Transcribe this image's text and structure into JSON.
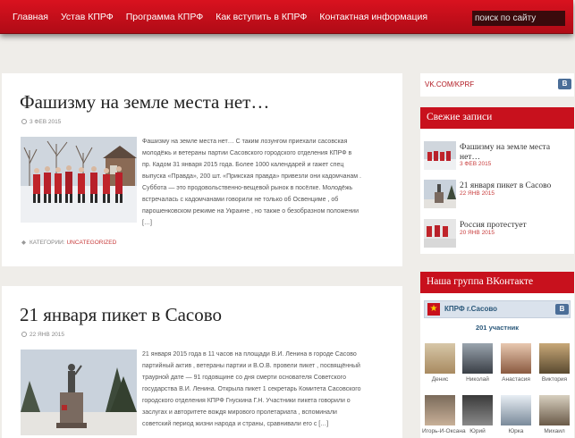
{
  "nav": {
    "items": [
      "Главная",
      "Устав КПРФ",
      "Программа КПРФ",
      "Как вступить в КПРФ",
      "Контактная информация"
    ],
    "search_placeholder": "поиск по сайту"
  },
  "posts": [
    {
      "title": "Фашизму на земле места нет…",
      "date": "3 ФЕВ 2015",
      "excerpt": "Фашизму на земле места нет… С таким лозунгом приехали сасовская молодёжь и ветераны партии Сасовского городского отделения КПРФ в пр. Кадом 31 января 2015 года. Более 1000 календарей и гажет спец выпуска «Правда», 200 шт. «Прикская правда» привезли они кадомчанам . Суббота — это продовольственно-вещевой рынок в посёлке. Молодёжь встречалась с кадомчанами говорили не только об Освенциме , об парошенковском режиме на Украине , но также о безобразном положении […]",
      "category_label": "КАТЕГОРИИ:",
      "category": "UNCATEGORIZED"
    },
    {
      "title": "21 января пикет в Сасово",
      "date": "22 ЯНВ 2015",
      "excerpt": "21 января 2015 года в 11 часов на площади В.И. Ленина в городе Сасово партийный актив , ветераны партии и В.О.В. провели пикет , посвящённый траурной дате — 91 годовщине со дня смерти основателя Советского государства В.И. Ленина. Открыла пикет 1 секретарь Комитета Сасовского городского отделения КПРФ Гнускина Г.Н. Участники пикета говорили о заслугах и авторитете вождя мирового пролетариата , вспоминали советский период жизни народа и страны, сравнивали его с […]"
    }
  ],
  "sidebar": {
    "vk_link": "VK.COM/KPRF",
    "vk_logo": "B",
    "recent_heading": "Свежие записи",
    "recent": [
      {
        "title": "Фашизму на земле места нет…",
        "date": "3 ФЕВ 2015"
      },
      {
        "title": "21 января пикет в Сасово",
        "date": "22 ЯНВ 2015"
      },
      {
        "title": "Россия протестует",
        "date": "20 ЯНВ 2015"
      }
    ],
    "group_heading": "Наша группа ВКонтакте",
    "group": {
      "name": "КПРФ г.Сасово",
      "logo": "B",
      "star": "★",
      "count": "201 участник",
      "members": [
        "Денис",
        "Николай",
        "Анастасия",
        "Виктория",
        "Игорь-И-Оксана",
        "Юрий",
        "Юрка",
        "Михаил"
      ]
    }
  },
  "colors": {
    "nav_red": "#c8111d",
    "link_red": "#c83c3c",
    "vk_blue": "#4b6e98"
  }
}
